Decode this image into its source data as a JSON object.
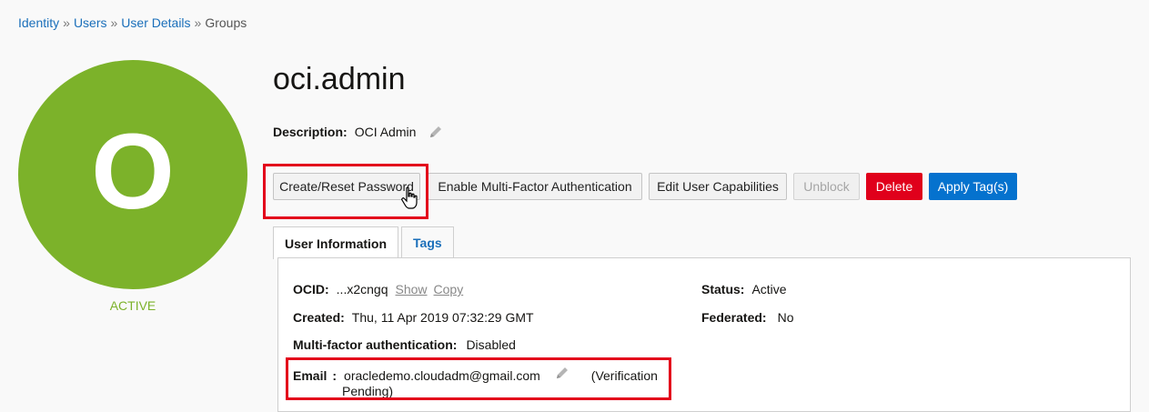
{
  "breadcrumb": {
    "items": [
      "Identity",
      "Users",
      "User Details"
    ],
    "current": "Groups",
    "separator": "»"
  },
  "user": {
    "avatar_letter": "O",
    "avatar_color": "#7cb22a",
    "status_label": "ACTIVE",
    "name": "oci.admin",
    "description_label": "Description:",
    "description": "OCI Admin"
  },
  "actions": {
    "create_reset_password": "Create/Reset Password",
    "enable_mfa": "Enable Multi-Factor Authentication",
    "edit_capabilities": "Edit User Capabilities",
    "unblock": "Unblock",
    "delete": "Delete",
    "apply_tags": "Apply Tag(s)"
  },
  "tabs": {
    "user_information": "User Information",
    "tags": "Tags"
  },
  "info": {
    "ocid_label": "OCID:",
    "ocid_value": "...x2cngq",
    "ocid_show": "Show",
    "ocid_copy": "Copy",
    "created_label": "Created:",
    "created_value": "Thu, 11 Apr 2019 07:32:29 GMT",
    "mfa_label": "Multi-factor authentication:",
    "mfa_value": "Disabled",
    "email_label": "Email",
    "email_colon": ":",
    "email_value": "oracledemo.cloudadm@gmail.com",
    "email_status_line1": "(Verification",
    "email_status_line2": "Pending)",
    "status_label": "Status:",
    "status_value": "Active",
    "federated_label": "Federated:",
    "federated_value": "No"
  },
  "colors": {
    "link": "#1a6fba",
    "danger": "#e0001b",
    "primary": "#0572ce",
    "highlight": "#e3001b"
  }
}
